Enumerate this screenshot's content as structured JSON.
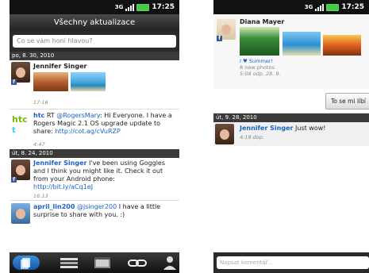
{
  "status": {
    "network": "3G",
    "time": "17:25"
  },
  "left": {
    "title": "Všechny aktualizace",
    "search_placeholder": "Co se vám honí hlavou?",
    "groups": [
      {
        "date": "po, 8. 30, 2010",
        "posts": [
          {
            "name": "Jennifer Singer",
            "time": "17:16"
          },
          {
            "name": "htc",
            "rt": "RT",
            "mention": "@RogersMary",
            "text": ": Hi Everyone. I have a Rogers Magic 2.1 OS upgrade update to share: ",
            "link": "http://cot.ag/cVuRZP",
            "time": "4:47"
          }
        ]
      },
      {
        "date": "út, 8. 24, 2010",
        "posts": [
          {
            "name": "Jennifer Singer",
            "text": " I've been using Goggles and I think you might like it. Check it out from your Android phone: ",
            "link": "http://bit.ly/aCq1eJ",
            "time": "16:13"
          },
          {
            "name": "april_lin200",
            "mention": "@jsinger200",
            "text": " I have a little surprise to share with you. :)"
          }
        ]
      }
    ]
  },
  "right": {
    "post": {
      "name": "Diana Mayer",
      "album": "I ♥ Summer!",
      "photos": "8 new photos",
      "time": "5:08 odp. 28. 9."
    },
    "like_label": "To se mi líbí",
    "date": "út, 9. 28, 2010",
    "comment": {
      "name": "Jennifer Singer",
      "text": " Just wow!",
      "time": "4:19 dop."
    },
    "comment_placeholder": "Napsat komentář..."
  }
}
